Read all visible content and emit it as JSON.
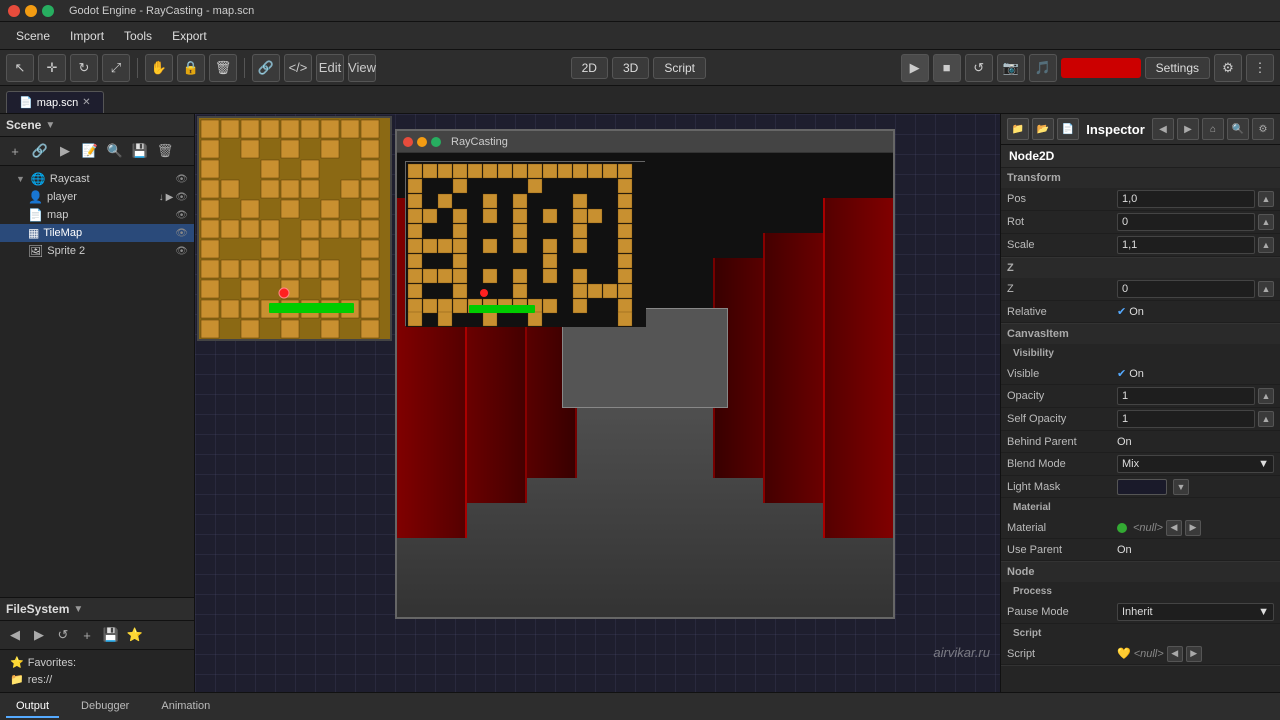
{
  "titlebar": {
    "title": "Godot Engine - RayCasting - map.scn"
  },
  "menubar": {
    "items": [
      "Scene",
      "Import",
      "Tools",
      "Export"
    ]
  },
  "toolbar": {
    "modes": [
      "2D",
      "3D",
      "Script"
    ],
    "settings_label": "Settings",
    "inspector_label": "Inspector"
  },
  "tabs": [
    {
      "label": "map.scn",
      "active": true
    }
  ],
  "scene_panel": {
    "title": "Scene",
    "tree": [
      {
        "label": "Raycast",
        "icon": "🌍",
        "indent": 0,
        "expanded": true
      },
      {
        "label": "player",
        "icon": "👤",
        "indent": 1
      },
      {
        "label": "map",
        "icon": "📄",
        "indent": 1
      },
      {
        "label": "TileMap",
        "icon": "▦",
        "indent": 1
      },
      {
        "label": "Sprite 2",
        "icon": "🖼",
        "indent": 1
      }
    ]
  },
  "filesystem_panel": {
    "title": "FileSystem",
    "favorites_label": "Favorites:",
    "items": [
      "res://"
    ]
  },
  "game_window": {
    "title": "RayCasting"
  },
  "inspector": {
    "title": "Inspector",
    "node_type": "Node2D",
    "sections": {
      "transform": {
        "title": "Transform",
        "fields": [
          {
            "name": "Pos",
            "value": "1,0"
          },
          {
            "name": "Rot",
            "value": "0"
          },
          {
            "name": "Scale",
            "value": "1,1"
          }
        ]
      },
      "z": {
        "title": "Z",
        "fields": [
          {
            "name": "Z",
            "value": "0"
          },
          {
            "name": "Relative",
            "check": "On"
          }
        ]
      },
      "canvas_item": {
        "title": "CanvasItem",
        "sections": {
          "visibility": {
            "title": "Visibility",
            "fields": [
              {
                "name": "Visible",
                "check": "On"
              },
              {
                "name": "Opacity",
                "value": "1"
              },
              {
                "name": "Self Opacity",
                "value": "1"
              },
              {
                "name": "Behind Parent",
                "check": "On"
              },
              {
                "name": "Blend Mode",
                "dropdown": "Mix"
              },
              {
                "name": "Light Mask",
                "color": true
              }
            ]
          },
          "material": {
            "title": "Material",
            "fields": [
              {
                "name": "Material",
                "null_value": "<null>",
                "has_dot": true
              },
              {
                "name": "Use Parent",
                "check": "On"
              }
            ]
          }
        }
      },
      "node": {
        "title": "Node",
        "sections": {
          "process": {
            "title": "Process",
            "fields": [
              {
                "name": "Pause Mode",
                "dropdown": "Inherit"
              }
            ]
          },
          "script": {
            "title": "Script",
            "fields": [
              {
                "name": "Script",
                "null_value": "<null>",
                "has_script_icon": true
              }
            ]
          }
        }
      }
    }
  },
  "bottom_tabs": [
    "Output",
    "Debugger",
    "Animation"
  ],
  "watermark": "airvikar.ru"
}
